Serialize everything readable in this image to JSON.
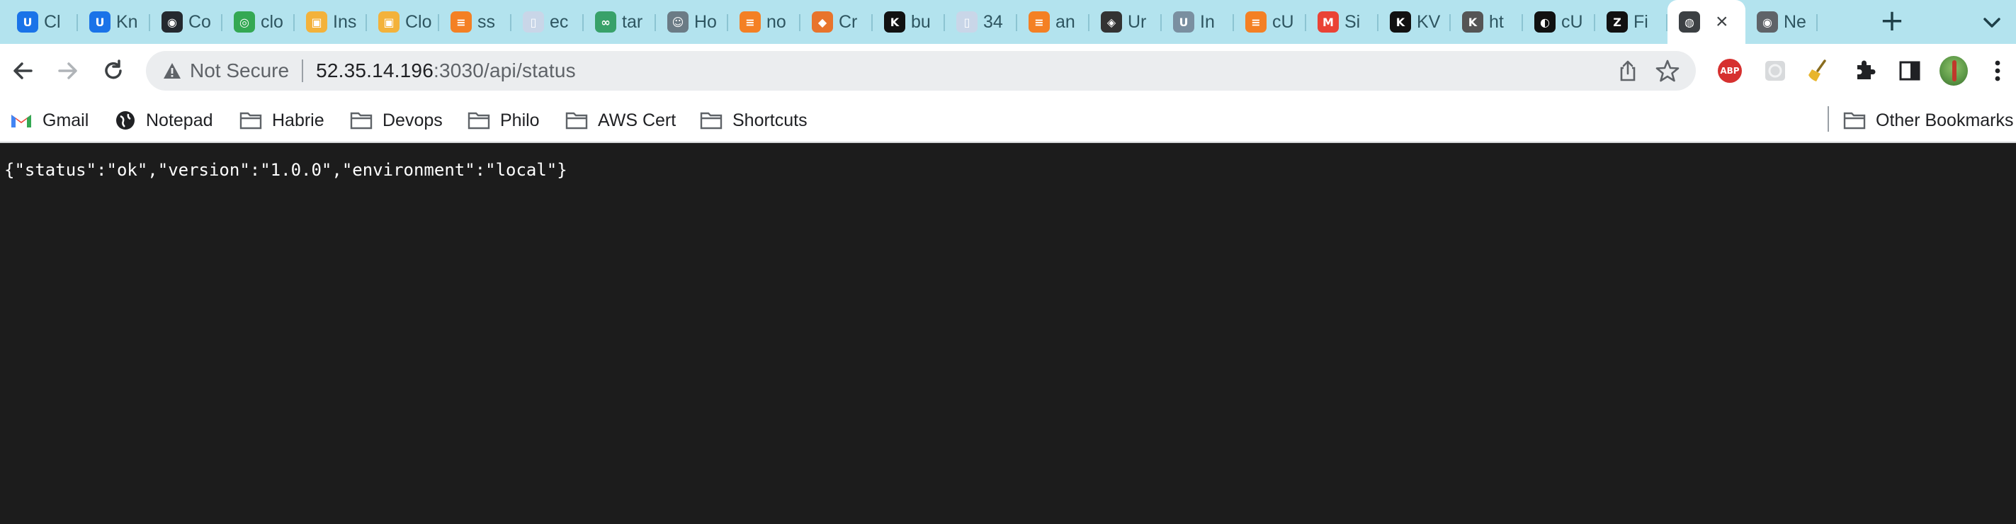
{
  "colors": {
    "tabstrip_bg": "#b3e3ee",
    "page_bg": "#1c1c1c",
    "page_text": "#ffffff"
  },
  "tabs": [
    {
      "title": "Cl",
      "icon": "u-logo-icon",
      "color": "#1a73e8",
      "glyph": "U"
    },
    {
      "title": "Kn",
      "icon": "u-logo-icon",
      "color": "#1a73e8",
      "glyph": "U"
    },
    {
      "title": "Co",
      "icon": "github-icon",
      "color": "#24292f",
      "glyph": "◉"
    },
    {
      "title": "clo",
      "icon": "circleci-icon",
      "color": "#34a853",
      "glyph": "◎"
    },
    {
      "title": "Ins",
      "icon": "aws-box-icon",
      "color": "#f3b23b",
      "glyph": "▣"
    },
    {
      "title": "Clo",
      "icon": "aws-box-icon",
      "color": "#f3b23b",
      "glyph": "▣"
    },
    {
      "title": "ss",
      "icon": "stackoverflow-icon",
      "color": "#f48024",
      "glyph": "≡"
    },
    {
      "title": "ec",
      "icon": "document-icon",
      "color": "#c9d6e8",
      "glyph": "▯"
    },
    {
      "title": "tar",
      "icon": "infinity-icon",
      "color": "#38a169",
      "glyph": "∞"
    },
    {
      "title": "Ho",
      "icon": "chat-icon",
      "color": "#6b7b85",
      "glyph": "☺"
    },
    {
      "title": "no",
      "icon": "stackoverflow-icon",
      "color": "#f48024",
      "glyph": "≡"
    },
    {
      "title": "Cr",
      "icon": "cube-icon",
      "color": "#e8742c",
      "glyph": "◆"
    },
    {
      "title": "bu",
      "icon": "kv-icon",
      "color": "#111111",
      "glyph": "K"
    },
    {
      "title": "34",
      "icon": "document-icon",
      "color": "#c9d6e8",
      "glyph": "▯"
    },
    {
      "title": "an",
      "icon": "stackoverflow-icon",
      "color": "#f48024",
      "glyph": "≡"
    },
    {
      "title": "Ur",
      "icon": "diamond-icon",
      "color": "#333333",
      "glyph": "◈"
    },
    {
      "title": "In",
      "icon": "ul-logo-icon",
      "color": "#7a8fa0",
      "glyph": "U"
    },
    {
      "title": "cU",
      "icon": "stackoverflow-icon",
      "color": "#f48024",
      "glyph": "≡"
    },
    {
      "title": "Si",
      "icon": "gmail-icon",
      "color": "#ea4335",
      "glyph": "M"
    },
    {
      "title": "KV",
      "icon": "kv-icon",
      "color": "#111111",
      "glyph": "K"
    },
    {
      "title": "ht",
      "icon": "kv-icon",
      "color": "#555555",
      "glyph": "K"
    },
    {
      "title": "cU",
      "icon": "circle-logo-icon",
      "color": "#111111",
      "glyph": "◐"
    },
    {
      "title": "Fi",
      "icon": "z-logo-icon",
      "color": "#111111",
      "glyph": "Z"
    },
    {
      "title": "",
      "icon": "globe-icon",
      "color": "#3c4043",
      "glyph": "◍",
      "active": true
    },
    {
      "title": "Ne",
      "icon": "chrome-icon",
      "color": "#5f6368",
      "glyph": "◉"
    }
  ],
  "toolbar": {
    "security_label": "Not Secure",
    "url_host": "52.35.14.196",
    "url_path": ":3030/api/status"
  },
  "bookmarks": {
    "items": [
      {
        "label": "Gmail",
        "icon": "gmail-icon"
      },
      {
        "label": "Notepad",
        "icon": "globe-icon"
      },
      {
        "label": "Habrie",
        "icon": "folder-icon"
      },
      {
        "label": "Devops",
        "icon": "folder-icon"
      },
      {
        "label": "Philo",
        "icon": "folder-icon"
      },
      {
        "label": "AWS Cert",
        "icon": "folder-icon"
      },
      {
        "label": "Shortcuts",
        "icon": "folder-icon"
      }
    ],
    "other_label": "Other Bookmarks"
  },
  "page": {
    "body_text": "{\"status\":\"ok\",\"version\":\"1.0.0\",\"environment\":\"local\"}"
  }
}
